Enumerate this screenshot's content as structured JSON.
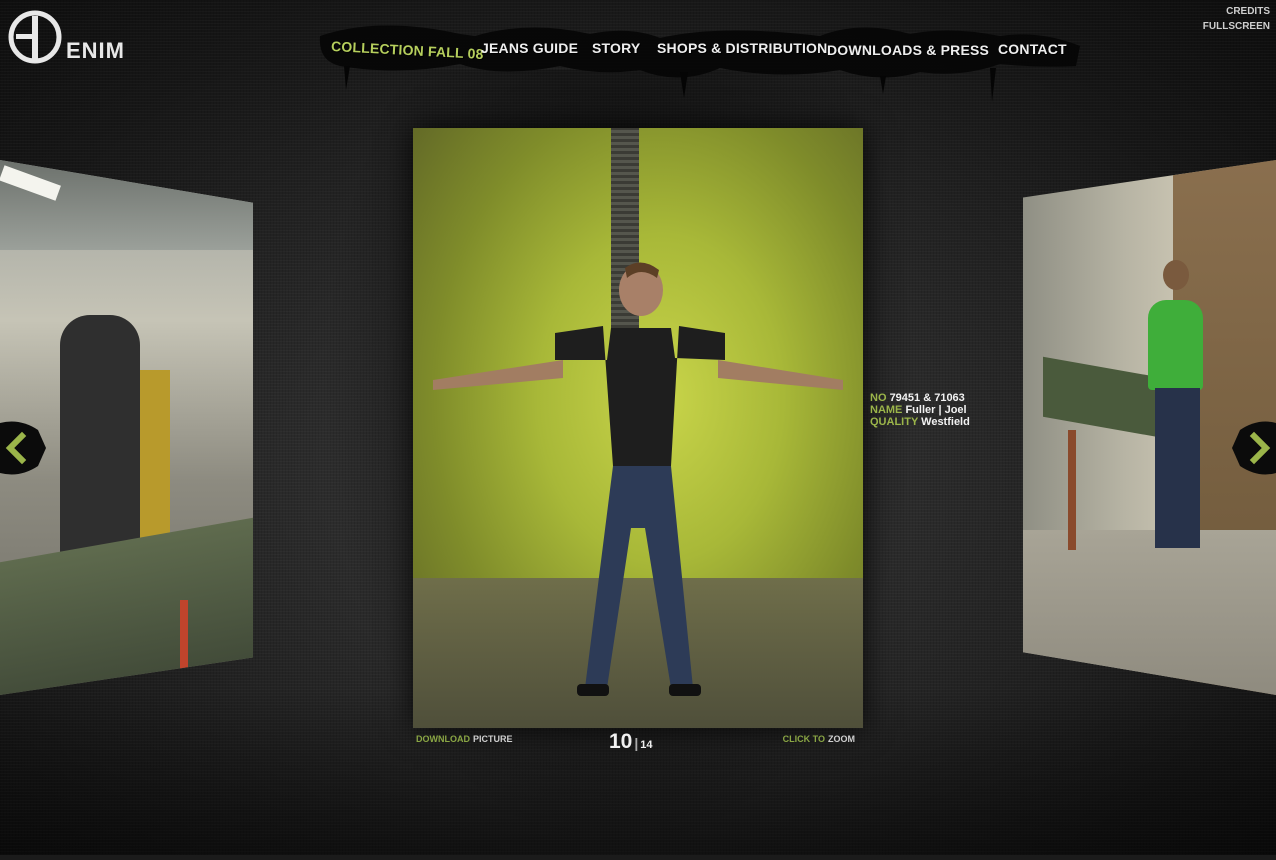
{
  "logo": {
    "text": "ENIM"
  },
  "nav": {
    "items": [
      {
        "label": "COLLECTION FALL 08",
        "active": true
      },
      {
        "label": "JEANS GUIDE",
        "active": false
      },
      {
        "label": "STORY",
        "active": false
      },
      {
        "label": "SHOPS & DISTRIBUTION",
        "active": false
      },
      {
        "label": "DOWNLOADS & PRESS",
        "active": false
      },
      {
        "label": "CONTACT",
        "active": false
      }
    ]
  },
  "top_links": {
    "credits": "CREDITS",
    "fullscreen": "FULLSCREEN"
  },
  "arrows": {
    "left": "chevron-left-icon",
    "right": "chevron-right-icon"
  },
  "info": {
    "no_label": "NO",
    "no_value": "79451 & 71063",
    "name_label": "NAME",
    "name_value": "Fuller | Joel",
    "quality_label": "QUALITY",
    "quality_value": "Westfield"
  },
  "bottom": {
    "download_label": "DOWNLOAD",
    "download_object": "PICTURE",
    "counter_current": "10",
    "counter_total": "14",
    "zoom_label": "CLICK TO",
    "zoom_action": "ZOOM"
  },
  "colors": {
    "accent": "#9bb54a",
    "text_light": "#f2f2f2",
    "background": "#1b1b1b"
  }
}
